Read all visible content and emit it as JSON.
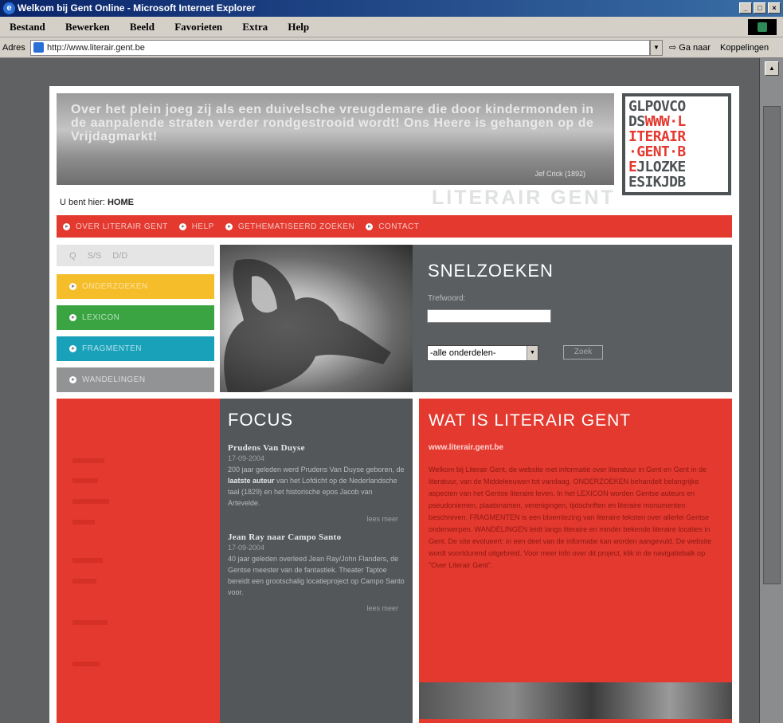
{
  "window": {
    "title": "Welkom bij Gent Online - Microsoft Internet Explorer",
    "menu": [
      "Bestand",
      "Bewerken",
      "Beeld",
      "Favorieten",
      "Extra",
      "Help"
    ],
    "address_label": "Adres",
    "url": "http://www.literair.gent.be",
    "go_label": "Ga naar",
    "links_label": "Koppelingen"
  },
  "banner": {
    "quote": "Over het plein joeg zij als een duivelsche vreugdemare die door kindermonden in de aanpalende straten verder rondgestrooid wordt! Ons Heere is gehangen op de Vrijdagmarkt!",
    "credit": "Jef Crick (1892)",
    "wordmark": "LITERAIR GENT"
  },
  "logo": {
    "line1": "GLPOVCO",
    "line2_dark": "DS",
    "line2_red": "WWW·L",
    "line3": "ITERAIR",
    "line4": "·GENT·B",
    "line5_red": "E",
    "line5_dark": "JLOZKE",
    "line6": "ESIKJDB"
  },
  "breadcrumb": {
    "label": "U bent hier:",
    "current": "HOME"
  },
  "nav": [
    "OVER LITERAIR GENT",
    "HELP",
    "GETHEMATISEERD ZOEKEN",
    "CONTACT"
  ],
  "tools": [
    "Q",
    "S/S",
    "D/D"
  ],
  "categories": [
    "ONDERZOEKEN",
    "LEXICON",
    "FRAGMENTEN",
    "WANDELINGEN"
  ],
  "search": {
    "title": "SNELZOEKEN",
    "label": "Trefwoord:",
    "select_value": "-alle onderdelen-",
    "button": "Zoek"
  },
  "focus": {
    "title": "FOCUS",
    "items": [
      {
        "title": "Prudens Van Duyse",
        "date": "17-09-2004",
        "body_pre": "200 jaar geleden werd Prudens Van Duyse geboren, de ",
        "body_bold": "laatste auteur",
        "body_post": " van het Lofdicht op de Nederlandsche taal (1829) en het historische epos Jacob van Artevelde.",
        "more": "lees meer"
      },
      {
        "title": "Jean Ray naar Campo Santo",
        "date": "17-09-2004",
        "body": "40 jaar geleden overleed Jean Ray/John Flanders, de Gentse meester van de fantastiek. Theater Taptoe bereidt een grootschalig locatieproject op Campo Santo voor.",
        "more": "lees meer"
      }
    ]
  },
  "about": {
    "title": "WAT IS LITERAIR GENT",
    "url": "www.literair.gent.be",
    "body": "Welkom bij Literair Gent, de website met informatie over literatuur in Gent en Gent in de literatuur, van de Middeleeuwen tot vandaag. ONDERZOEKEN behandelt belangrijke aspecten van het Gentse literaire leven. In het LEXICON worden Gentse auteurs en pseudoniemen, plaatsnamen, verenigingen, tijdschriften en literaire monumenten beschreven. FRAGMENTEN is een bloemlezing van literaire teksten over allerlei Gentse onderwerpen. WANDELINGEN leidt langs literaire en minder bekende literaire locaties in Gent. De site evolueert: in een deel van de informatie kan worden aangevuld. De website wordt voortdurend uitgebreid. Voor meer info over dit project, klik in de navigatiebalk op \"Over Literair Gent\"."
  }
}
